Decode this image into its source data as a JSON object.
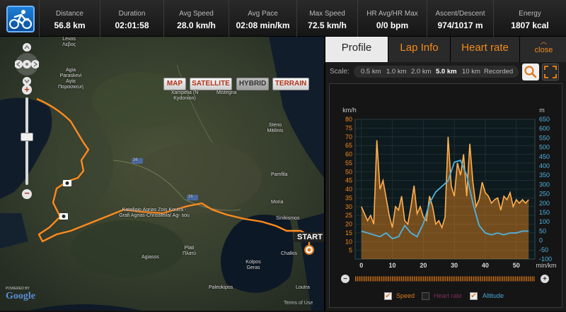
{
  "app": {
    "sport_icon": "cycling-icon"
  },
  "stats": [
    {
      "label": "Distance",
      "value": "56.8 km"
    },
    {
      "label": "Duration",
      "value": "02:01:58"
    },
    {
      "label": "Avg Speed",
      "value": "28.0 km/h"
    },
    {
      "label": "Avg Pace",
      "value": "02:08 min/km"
    },
    {
      "label": "Max Speed",
      "value": "72.5 km/h"
    },
    {
      "label": "HR Avg/HR Max",
      "value": "0/0 bpm"
    },
    {
      "label": "Ascent/Descent",
      "value": "974/1017 m"
    },
    {
      "label": "Energy",
      "value": "1807 kcal"
    }
  ],
  "map": {
    "types": [
      "MAP",
      "SATELLITE",
      "HYBRID",
      "TERRAIN"
    ],
    "selected_type": "HYBRID",
    "start_label": "START",
    "powered_by": "POWERED BY",
    "google": "Google",
    "terms": "Terms of Use",
    "places": [
      {
        "name": "Levos",
        "sub": "Λεβος"
      },
      {
        "name": "Agia Paraskevi",
        "sub": "Αγία Παρασκευή"
      },
      {
        "name": "Xampelia (N Kydonion)",
        "sub": ""
      },
      {
        "name": "Mistegna",
        "sub": ""
      },
      {
        "name": "Steno Mitilinis",
        "sub": ""
      },
      {
        "name": "Pamfila",
        "sub": ""
      },
      {
        "name": "Moria",
        "sub": ""
      },
      {
        "name": "Sinikismos",
        "sub": ""
      },
      {
        "name": "Katafigio Agrias Zois Koutra - Grafi Agrias-Chrisafeila/ Ag- sou",
        "sub": ""
      },
      {
        "name": "Plati",
        "sub": "Πλατύ"
      },
      {
        "name": "Agiasos",
        "sub": ""
      },
      {
        "name": "Kolpos Geras",
        "sub": ""
      },
      {
        "name": "Chalkis",
        "sub": ""
      },
      {
        "name": "Paleokipos",
        "sub": ""
      },
      {
        "name": "Loutra",
        "sub": ""
      }
    ],
    "road_numbers": [
      "36",
      "36"
    ]
  },
  "panel": {
    "tabs": [
      "Profile",
      "Lap Info",
      "Heart rate"
    ],
    "active_tab": "Profile",
    "close_label": "close",
    "scale_label": "Scale:",
    "scale_options": [
      "0.5 km",
      "1.0 km",
      "2.0 km",
      "5.0 km",
      "10 km",
      "Recorded"
    ],
    "selected_scale": "5.0 km",
    "legend": [
      {
        "label": "Speed",
        "checked": true,
        "color": "#e8892a"
      },
      {
        "label": "Heart rate",
        "checked": false,
        "color": "#7a2f5a"
      },
      {
        "label": "Altitude",
        "checked": true,
        "color": "#4aa8d8"
      }
    ]
  },
  "chart_data": {
    "type": "line",
    "xlabel": "min/km",
    "ylabel_left": "km/h",
    "ylabel_right": "m",
    "x_ticks": [
      0,
      10,
      20,
      30,
      40,
      50
    ],
    "y_left_ticks": [
      5,
      10,
      15,
      20,
      25,
      30,
      35,
      40,
      45,
      50,
      55,
      60,
      65,
      70,
      75,
      80
    ],
    "y_right_ticks": [
      -100,
      -50,
      0,
      50,
      100,
      150,
      200,
      250,
      300,
      350,
      400,
      450,
      500,
      550,
      600,
      650
    ],
    "xlim": [
      -2,
      56
    ],
    "ylim_left": [
      0,
      80
    ],
    "ylim_right": [
      -100,
      650
    ],
    "grid": true,
    "series": [
      {
        "name": "Speed",
        "axis": "left",
        "color": "#f08a20",
        "x": [
          0,
          2,
          3,
          4,
          5,
          6,
          7,
          8,
          9,
          10,
          11,
          12,
          13,
          14,
          15,
          16,
          17,
          18,
          19,
          20,
          21,
          22,
          23,
          24,
          25,
          26,
          27,
          28,
          29,
          30,
          31,
          32,
          33,
          34,
          35,
          36,
          37,
          38,
          39,
          40,
          41,
          42,
          43,
          44,
          45,
          46,
          47,
          48,
          49,
          50,
          51,
          52,
          53,
          54
        ],
        "y": [
          30,
          22,
          25,
          20,
          68,
          40,
          45,
          35,
          25,
          18,
          30,
          28,
          36,
          22,
          20,
          30,
          42,
          26,
          30,
          24,
          22,
          36,
          30,
          20,
          22,
          18,
          24,
          70,
          42,
          36,
          55,
          48,
          60,
          36,
          66,
          44,
          30,
          34,
          44,
          38,
          36,
          32,
          34,
          35,
          28,
          36,
          34,
          38,
          30,
          34,
          32,
          34,
          32,
          34
        ]
      },
      {
        "name": "Altitude",
        "axis": "right",
        "color": "#4fb3e0",
        "x": [
          0,
          2,
          4,
          6,
          8,
          10,
          12,
          14,
          16,
          18,
          20,
          22,
          24,
          26,
          28,
          30,
          32,
          34,
          36,
          38,
          40,
          42,
          44,
          46,
          48,
          50,
          52,
          54
        ],
        "y": [
          50,
          40,
          30,
          20,
          40,
          10,
          20,
          80,
          40,
          20,
          90,
          200,
          260,
          290,
          320,
          420,
          430,
          350,
          200,
          80,
          40,
          30,
          40,
          30,
          40,
          40,
          50,
          50
        ]
      }
    ]
  }
}
